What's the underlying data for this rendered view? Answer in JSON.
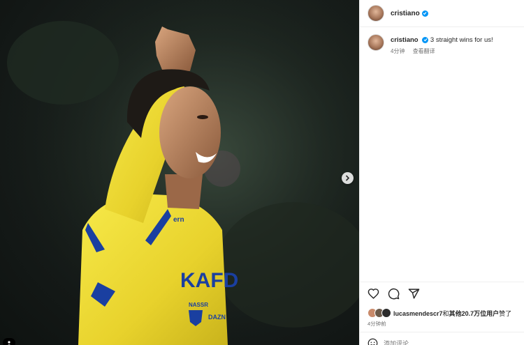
{
  "post": {
    "username": "cristiano",
    "verified": true
  },
  "caption": {
    "username": "cristiano",
    "text": "3 straight wins for us!",
    "time": "4分钟",
    "translate": "查看翻译"
  },
  "actions": {
    "like_icon": "heart-icon",
    "comment_icon": "comment-icon",
    "share_icon": "send-icon"
  },
  "likes": {
    "user": "lucasmendescr7",
    "connector": "和",
    "others": "其他20.7万位用户",
    "suffix": "赞了"
  },
  "time_ago": "4分钟前",
  "comment": {
    "placeholder": "添加评论..."
  },
  "media": {
    "jersey_text_1": "KAFD",
    "jersey_text_2": "NASSR",
    "jersey_text_3": "DAZN",
    "sponsor": "ern"
  },
  "colors": {
    "accent": "#0095f6",
    "jersey": "#f3e23b",
    "jersey_trim": "#1a3fa0"
  }
}
